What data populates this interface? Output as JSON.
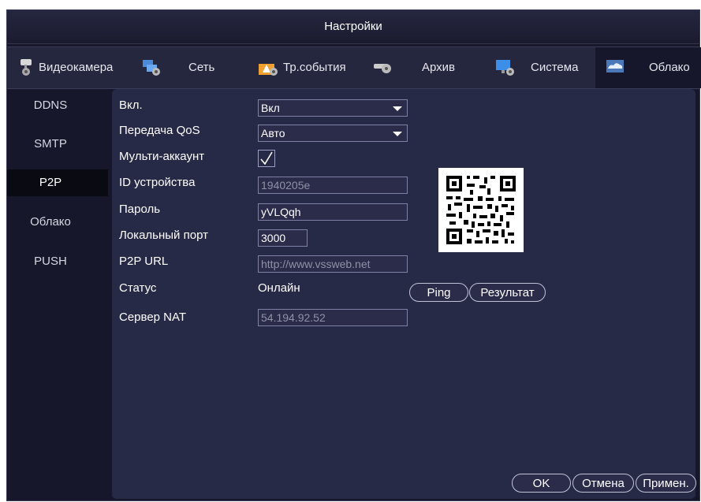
{
  "window": {
    "title": "Настройки"
  },
  "tabs": [
    {
      "label": "Видеокамера",
      "icon": "camera-gear-icon"
    },
    {
      "label": "Сеть",
      "icon": "network-gear-icon"
    },
    {
      "label": "Тр.события",
      "icon": "alarm-gear-icon"
    },
    {
      "label": "Архив",
      "icon": "storage-gear-icon"
    },
    {
      "label": "Система",
      "icon": "monitor-gear-icon"
    },
    {
      "label": "Облако",
      "icon": "cloud-icon"
    }
  ],
  "sidebar": {
    "items": [
      "DDNS",
      "SMTP",
      "P2P",
      "Облако",
      "PUSH"
    ],
    "active": "P2P"
  },
  "form": {
    "enable": {
      "label": "Вкл.",
      "value": "Вкл"
    },
    "qos": {
      "label": "Передача QoS",
      "value": "Авто"
    },
    "multi_account": {
      "label": "Мульти-аккаунт",
      "checked": true,
      "mark": "√"
    },
    "device_id": {
      "label": "ID устройства",
      "value": "1940205e"
    },
    "password": {
      "label": "Пароль",
      "value": "yVLQqh"
    },
    "local_port": {
      "label": "Локальный порт",
      "value": "3000"
    },
    "p2p_url": {
      "label": "P2P URL",
      "value": "http://www.vssweb.net"
    },
    "status": {
      "label": "Статус",
      "value": "Онлайн"
    },
    "nat_server": {
      "label": "Сервер NAT",
      "value": "54.194.92.52"
    }
  },
  "buttons": {
    "ping": "Ping",
    "result": "Результат",
    "ok": "OK",
    "cancel": "Отмена",
    "apply": "Примен."
  },
  "colors": {
    "panel": "#272a46",
    "background": "#16172a",
    "tabbar": "#25273f",
    "active_side": "#090a12"
  }
}
